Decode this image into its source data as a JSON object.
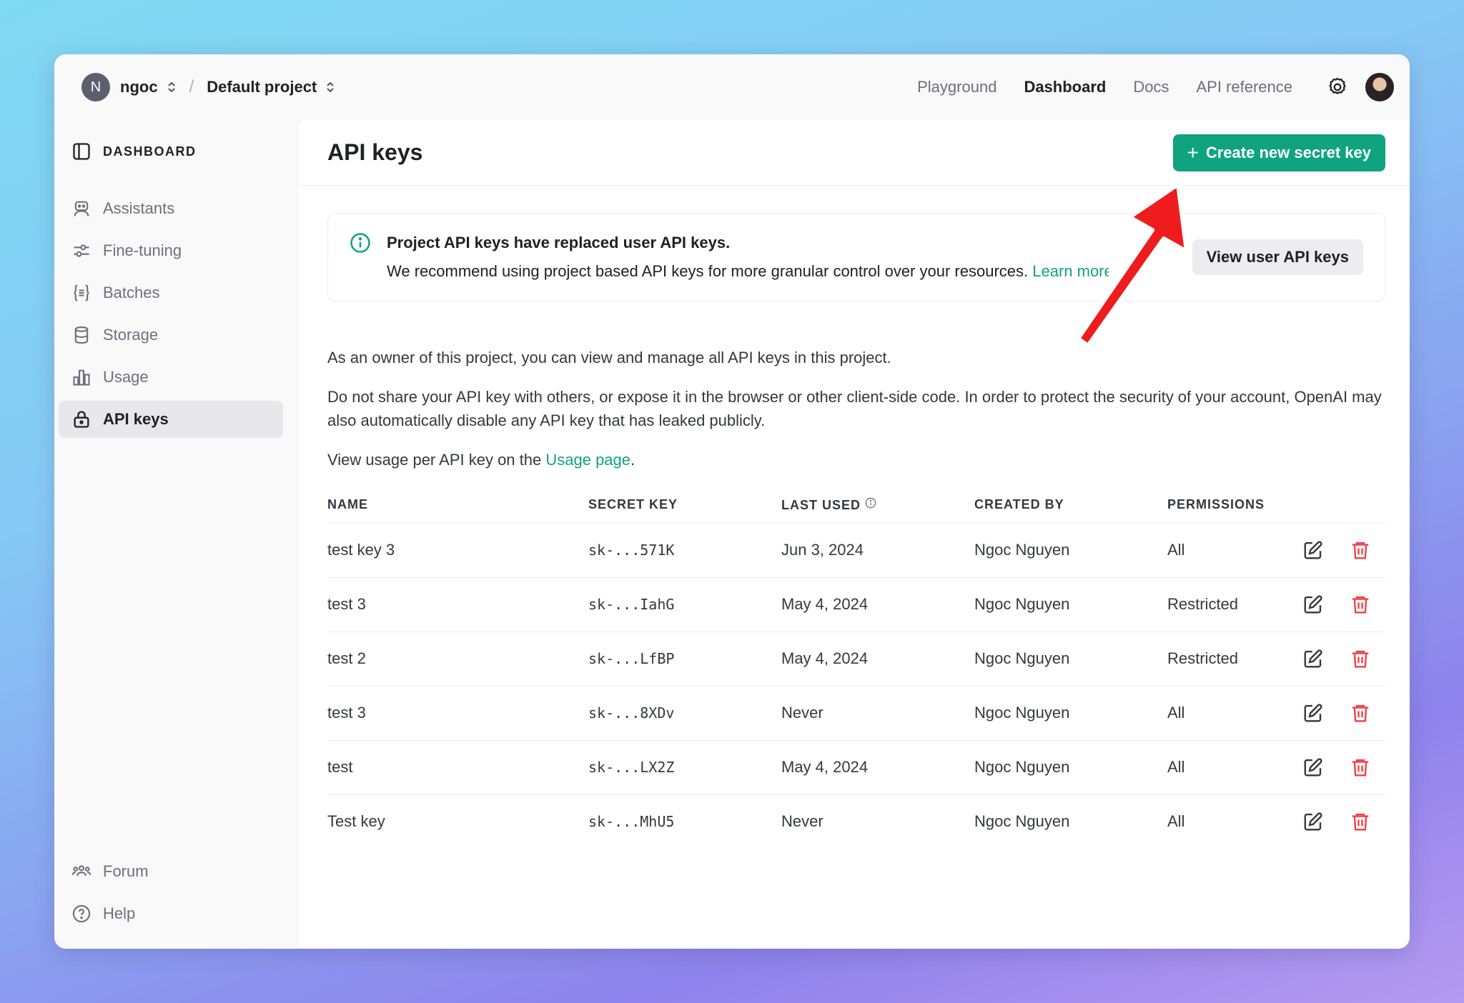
{
  "topbar": {
    "org_initial": "N",
    "org_name": "ngoc",
    "separator": "/",
    "project_name": "Default project",
    "nav": [
      "Playground",
      "Dashboard",
      "Docs",
      "API reference"
    ],
    "active_nav": "Dashboard",
    "settings_icon": "gear-icon",
    "user_avatar": "avatar"
  },
  "sidebar": {
    "header": "DASHBOARD",
    "items": [
      {
        "label": "Assistants",
        "icon": "robot-icon"
      },
      {
        "label": "Fine-tuning",
        "icon": "sliders-icon"
      },
      {
        "label": "Batches",
        "icon": "braces-icon"
      },
      {
        "label": "Storage",
        "icon": "database-icon"
      },
      {
        "label": "Usage",
        "icon": "bar-chart-icon"
      },
      {
        "label": "API keys",
        "icon": "lock-icon",
        "active": true
      }
    ],
    "bottom": [
      {
        "label": "Forum",
        "icon": "people-icon"
      },
      {
        "label": "Help",
        "icon": "help-icon"
      }
    ]
  },
  "main": {
    "title": "API keys",
    "create_button": "Create new secret key",
    "create_plus": "+",
    "banner": {
      "title": "Project API keys have replaced user API keys.",
      "body": "We recommend using project based API keys for more granular control over your resources. ",
      "link": "Learn more",
      "button": "View user API keys"
    },
    "para1": "As an owner of this project, you can view and manage all API keys in this project.",
    "para2": "Do not share your API key with others, or expose it in the browser or other client-side code. In order to protect the security of your account, OpenAI may also automatically disable any API key that has leaked publicly.",
    "para3_prefix": "View usage per API key on the ",
    "para3_link": "Usage page",
    "para3_suffix": ".",
    "table": {
      "headers": [
        "NAME",
        "SECRET KEY",
        "LAST USED",
        "CREATED BY",
        "PERMISSIONS"
      ],
      "rows": [
        {
          "name": "test key 3",
          "key": "sk-...571K",
          "last_used": "Jun 3, 2024",
          "created_by": "Ngoc Nguyen",
          "permissions": "All"
        },
        {
          "name": "test 3",
          "key": "sk-...IahG",
          "last_used": "May 4, 2024",
          "created_by": "Ngoc Nguyen",
          "permissions": "Restricted"
        },
        {
          "name": "test 2",
          "key": "sk-...LfBP",
          "last_used": "May 4, 2024",
          "created_by": "Ngoc Nguyen",
          "permissions": "Restricted"
        },
        {
          "name": "test 3",
          "key": "sk-...8XDv",
          "last_used": "Never",
          "created_by": "Ngoc Nguyen",
          "permissions": "All"
        },
        {
          "name": "test",
          "key": "sk-...LX2Z",
          "last_used": "May 4, 2024",
          "created_by": "Ngoc Nguyen",
          "permissions": "All"
        },
        {
          "name": "Test key",
          "key": "sk-...MhU5",
          "last_used": "Never",
          "created_by": "Ngoc Nguyen",
          "permissions": "All"
        }
      ]
    }
  },
  "colors": {
    "accent": "#10a37f",
    "danger": "#ef4146",
    "annotation_arrow": "#ee1c1c"
  }
}
